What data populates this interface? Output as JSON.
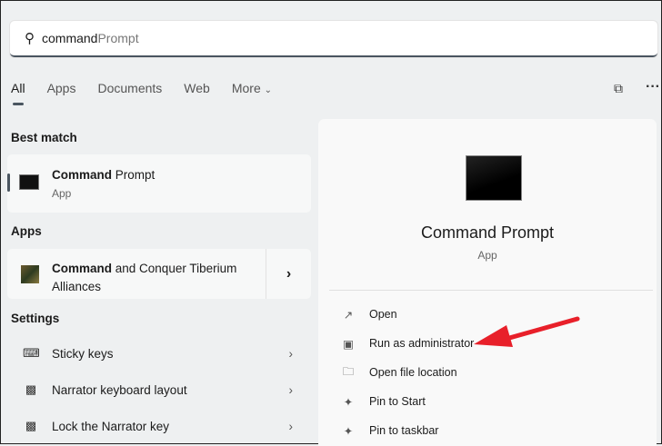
{
  "search": {
    "typed": "command",
    "suggested": " Prompt"
  },
  "tabs": [
    "All",
    "Apps",
    "Documents",
    "Web",
    "More"
  ],
  "best_match": {
    "header": "Best match",
    "title_bold": "Command",
    "title_rest": " Prompt",
    "subtitle": "App"
  },
  "apps": {
    "header": "Apps",
    "title_bold": "Command",
    "title_rest": " and Conquer Tiberium",
    "title_line2": "Alliances"
  },
  "settings": {
    "header": "Settings",
    "items": [
      "Sticky keys",
      "Narrator keyboard layout",
      "Lock the Narrator key"
    ]
  },
  "detail": {
    "title": "Command Prompt",
    "subtitle": "App",
    "actions": [
      "Open",
      "Run as administrator",
      "Open file location",
      "Pin to Start",
      "Pin to taskbar"
    ]
  },
  "annotation": {
    "arrow_color": "#e8202a"
  }
}
